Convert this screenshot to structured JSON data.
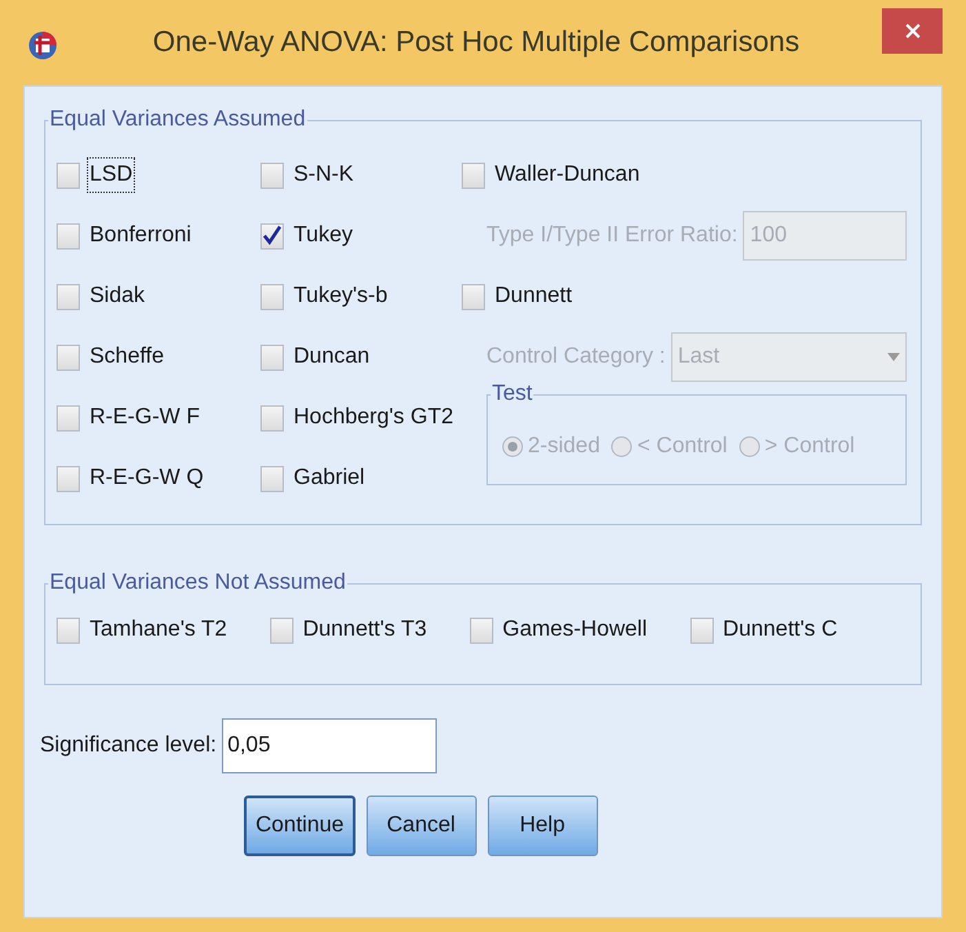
{
  "window": {
    "title": "One-Way ANOVA: Post Hoc Multiple Comparisons"
  },
  "equal_variances_assumed": {
    "legend": "Equal Variances Assumed",
    "column_1": [
      {
        "label": "LSD",
        "checked": false,
        "focused": true
      },
      {
        "label": "Bonferroni",
        "checked": false,
        "focused": false
      },
      {
        "label": "Sidak",
        "checked": false,
        "focused": false
      },
      {
        "label": "Scheffe",
        "checked": false,
        "focused": false
      },
      {
        "label": "R-E-G-W F",
        "checked": false,
        "focused": false
      },
      {
        "label": "R-E-G-W Q",
        "checked": false,
        "focused": false
      }
    ],
    "column_2": [
      {
        "label": "S-N-K",
        "checked": false
      },
      {
        "label": "Tukey",
        "checked": true
      },
      {
        "label": "Tukey's-b",
        "checked": false
      },
      {
        "label": "Duncan",
        "checked": false
      },
      {
        "label": "Hochberg's GT2",
        "checked": false
      },
      {
        "label": "Gabriel",
        "checked": false
      }
    ],
    "waller_duncan": {
      "label": "Waller-Duncan",
      "checked": false
    },
    "error_ratio": {
      "label": "Type I/Type II Error Ratio:",
      "value": "100",
      "disabled": true
    },
    "dunnett": {
      "label": "Dunnett",
      "checked": false
    },
    "control_category": {
      "label": "Control Category :",
      "value": "Last",
      "disabled": true
    },
    "test": {
      "legend": "Test",
      "disabled": true,
      "options": [
        {
          "label": "2-sided",
          "selected": true
        },
        {
          "label": "< Control",
          "selected": false
        },
        {
          "label": "> Control",
          "selected": false
        }
      ]
    }
  },
  "equal_variances_not_assumed": {
    "legend": "Equal Variances Not Assumed",
    "tests": [
      {
        "label": "Tamhane's T2",
        "checked": false
      },
      {
        "label": "Dunnett's T3",
        "checked": false
      },
      {
        "label": "Games-Howell",
        "checked": false
      },
      {
        "label": "Dunnett's C",
        "checked": false
      }
    ]
  },
  "significance_level": {
    "label": "Significance level:",
    "value": "0,05"
  },
  "buttons": [
    {
      "label": "Continue",
      "default": true
    },
    {
      "label": "Cancel",
      "default": false
    },
    {
      "label": "Help",
      "default": false
    }
  ]
}
